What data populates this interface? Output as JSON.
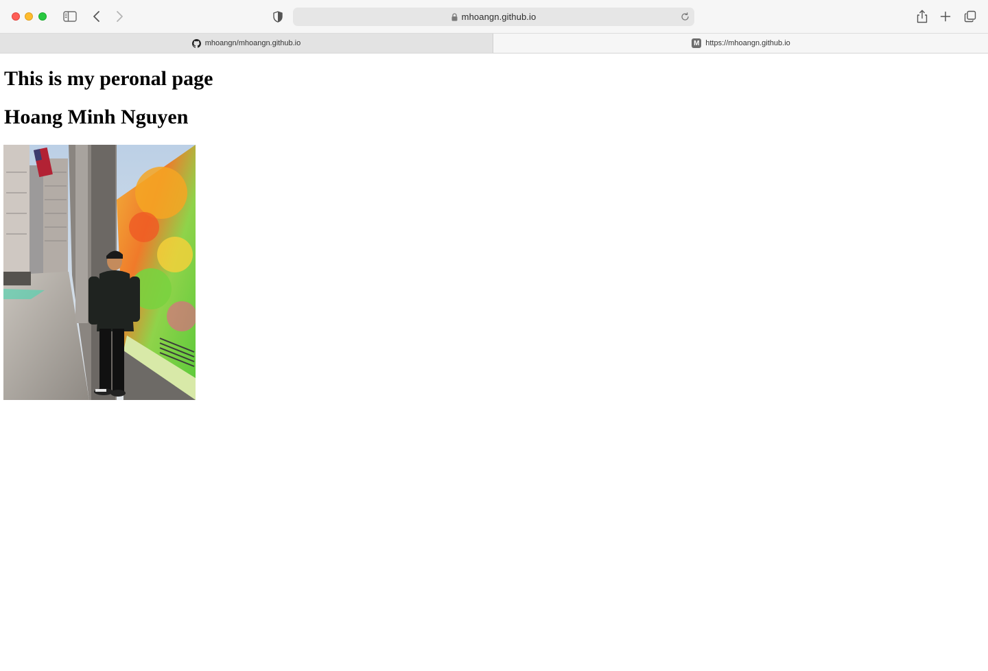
{
  "browser": {
    "address": "mhoangn.github.io",
    "tabs": [
      {
        "label": "mhoangn/mhoangn.github.io",
        "icon": "github-icon",
        "active": false
      },
      {
        "label": "https://mhoangn.github.io",
        "icon": "m-favicon-icon",
        "favicon_letter": "M",
        "active": true
      }
    ]
  },
  "page": {
    "title": "This is my peronal page",
    "name": "Hoang Minh Nguyen",
    "photo": {
      "description_icon": "profile-photo"
    }
  },
  "colors": {
    "close": "#fe5f57",
    "minimize": "#febc2e",
    "zoom": "#28c840"
  }
}
